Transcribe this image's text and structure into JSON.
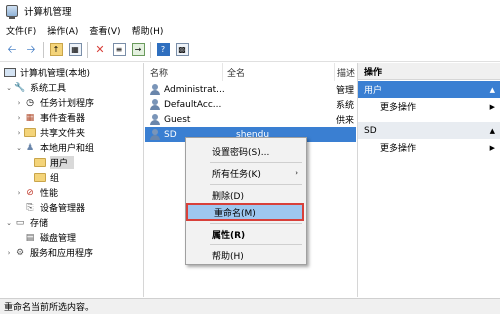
{
  "window": {
    "title": "计算机管理"
  },
  "menu": [
    "文件(F)",
    "操作(A)",
    "查看(V)",
    "帮助(H)"
  ],
  "toolbar": {
    "icons": [
      "back-icon",
      "forward-icon",
      "up-folder-icon",
      "show-tree-icon",
      "delete-icon",
      "properties-icon",
      "export-icon",
      "help-icon",
      "console-icon"
    ]
  },
  "tree": {
    "root": "计算机管理(本地)",
    "system_tools": "系统工具",
    "task_scheduler": "任务计划程序",
    "event_viewer": "事件查看器",
    "shared_folders": "共享文件夹",
    "local_users": "本地用户和组",
    "users": "用户",
    "groups": "组",
    "performance": "性能",
    "device_manager": "设备管理器",
    "storage": "存储",
    "disk_management": "磁盘管理",
    "services": "服务和应用程序"
  },
  "list": {
    "columns": {
      "name": "名称",
      "full_name": "全名",
      "desc": "描述"
    },
    "rows": [
      {
        "name": "Administrat...",
        "full_name": "",
        "desc": "管理"
      },
      {
        "name": "DefaultAcc...",
        "full_name": "",
        "desc": "系统"
      },
      {
        "name": "Guest",
        "full_name": "",
        "desc": "供来"
      },
      {
        "name": "SD",
        "full_name": "shendu",
        "desc": ""
      }
    ]
  },
  "actions": {
    "title": "操作",
    "section1": "用户",
    "section1_item": "更多操作",
    "section2": "SD",
    "section2_item": "更多操作"
  },
  "context_menu": {
    "set_password": "设置密码(S)...",
    "all_tasks": "所有任务(K)",
    "delete": "删除(D)",
    "rename": "重命名(M)",
    "properties": "属性(R)",
    "help": "帮助(H)"
  },
  "status": "重命名当前所选内容。",
  "colors": {
    "selection": "#3a7fd2",
    "highlight_border": "#d8403a",
    "menu_hover": "#9ec7ef"
  }
}
